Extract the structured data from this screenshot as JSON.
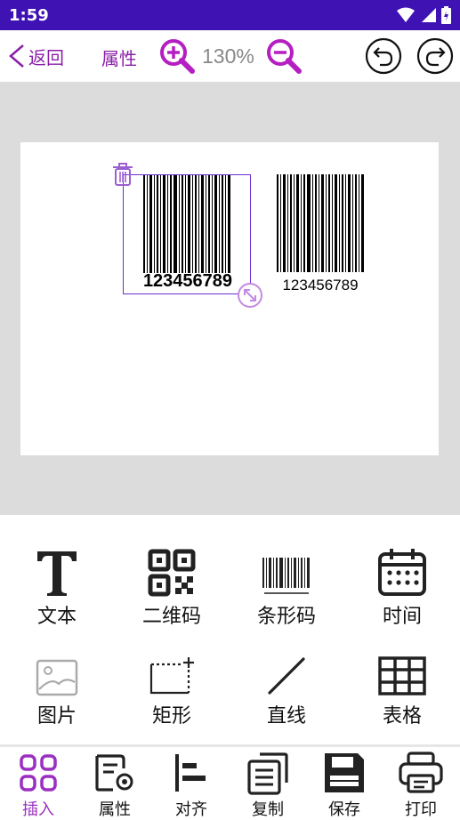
{
  "status_bar": {
    "time": "1:59"
  },
  "toolbar": {
    "back_label": "返回",
    "properties_label": "属性",
    "zoom_level": "130%"
  },
  "canvas": {
    "barcodes": [
      {
        "text": "123456789",
        "selected": true
      },
      {
        "text": "123456789",
        "selected": false
      }
    ]
  },
  "insert_panel": {
    "tools": [
      {
        "label": "文本",
        "icon": "text-icon"
      },
      {
        "label": "二维码",
        "icon": "qr-code-icon"
      },
      {
        "label": "条形码",
        "icon": "barcode-icon"
      },
      {
        "label": "时间",
        "icon": "calendar-icon"
      },
      {
        "label": "图片",
        "icon": "image-icon"
      },
      {
        "label": "矩形",
        "icon": "rectangle-icon"
      },
      {
        "label": "直线",
        "icon": "line-icon"
      },
      {
        "label": "表格",
        "icon": "table-icon"
      }
    ]
  },
  "bottom_nav": {
    "items": [
      {
        "label": "插入",
        "icon": "grid-icon",
        "active": true
      },
      {
        "label": "属性",
        "icon": "properties-icon",
        "active": false
      },
      {
        "label": "对齐",
        "icon": "align-icon",
        "active": false
      },
      {
        "label": "复制",
        "icon": "copy-icon",
        "active": false
      },
      {
        "label": "保存",
        "icon": "save-icon",
        "active": false
      },
      {
        "label": "打印",
        "icon": "print-icon",
        "active": false
      }
    ]
  },
  "colors": {
    "status_bar": "#3f12b4",
    "accent": "#9b2fc1",
    "workspace": "#dcdcdc"
  }
}
